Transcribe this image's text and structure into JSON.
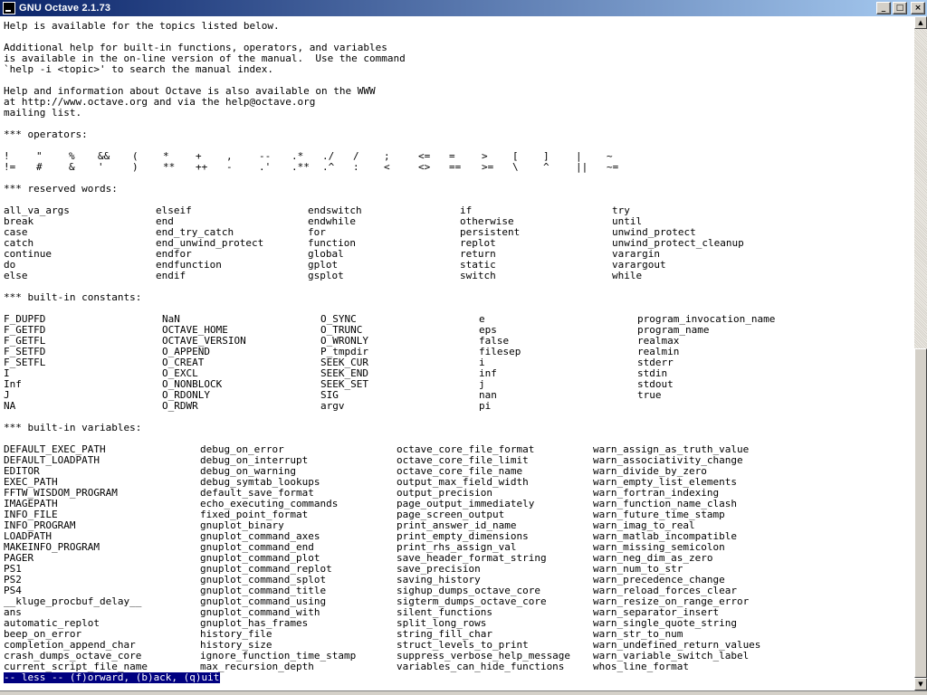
{
  "window": {
    "title": "GNU Octave 2.1.73",
    "minimize": "_",
    "maximize": "□",
    "close": "×"
  },
  "intro": [
    "Help is available for the topics listed below.",
    "",
    "Additional help for built-in functions, operators, and variables",
    "is available in the on-line version of the manual.  Use the command",
    "`help -i <topic>' to search the manual index.",
    "",
    "Help and information about Octave is also available on the WWW",
    "at http://www.octave.org and via the help@octave.org",
    "mailing list."
  ],
  "operators": {
    "heading": "*** operators:",
    "row1": [
      "!",
      "\"",
      "%",
      "&&",
      "(",
      "*",
      "+",
      ",",
      "--",
      ".*",
      "./",
      "/",
      ";",
      "<=",
      "=",
      ">",
      "[",
      "]",
      "|",
      "~"
    ],
    "row2": [
      "!=",
      "#",
      "&",
      "'",
      ")",
      "**",
      "++",
      "-",
      ".'",
      ".**",
      ".^",
      ":",
      "<",
      "<>",
      "==",
      ">=",
      "\\",
      "^",
      "||",
      "~="
    ]
  },
  "reserved": {
    "heading": "*** reserved words:",
    "rows": [
      [
        "all_va_args",
        "elseif",
        "endswitch",
        "if",
        "try"
      ],
      [
        "break",
        "end",
        "endwhile",
        "otherwise",
        "until"
      ],
      [
        "case",
        "end_try_catch",
        "for",
        "persistent",
        "unwind_protect"
      ],
      [
        "catch",
        "end_unwind_protect",
        "function",
        "replot",
        "unwind_protect_cleanup"
      ],
      [
        "continue",
        "endfor",
        "global",
        "return",
        "varargin"
      ],
      [
        "do",
        "endfunction",
        "gplot",
        "static",
        "varargout"
      ],
      [
        "else",
        "endif",
        "gsplot",
        "switch",
        "while"
      ]
    ]
  },
  "constants": {
    "heading": "*** built-in constants:",
    "rows": [
      [
        "F_DUPFD",
        "NaN",
        "O_SYNC",
        "e",
        "program_invocation_name"
      ],
      [
        "F_GETFD",
        "OCTAVE_HOME",
        "O_TRUNC",
        "eps",
        "program_name"
      ],
      [
        "F_GETFL",
        "OCTAVE_VERSION",
        "O_WRONLY",
        "false",
        "realmax"
      ],
      [
        "F_SETFD",
        "O_APPEND",
        "P_tmpdir",
        "filesep",
        "realmin"
      ],
      [
        "F_SETFL",
        "O_CREAT",
        "SEEK_CUR",
        "i",
        "stderr"
      ],
      [
        "I",
        "O_EXCL",
        "SEEK_END",
        "inf",
        "stdin"
      ],
      [
        "Inf",
        "O_NONBLOCK",
        "SEEK_SET",
        "j",
        "stdout"
      ],
      [
        "J",
        "O_RDONLY",
        "SIG",
        "nan",
        "true"
      ],
      [
        "NA",
        "O_RDWR",
        "argv",
        "pi",
        ""
      ]
    ]
  },
  "variables": {
    "heading": "*** built-in variables:",
    "rows": [
      [
        "DEFAULT_EXEC_PATH",
        "debug_on_error",
        "octave_core_file_format",
        "warn_assign_as_truth_value"
      ],
      [
        "DEFAULT_LOADPATH",
        "debug_on_interrupt",
        "octave_core_file_limit",
        "warn_associativity_change"
      ],
      [
        "EDITOR",
        "debug_on_warning",
        "octave_core_file_name",
        "warn_divide_by_zero"
      ],
      [
        "EXEC_PATH",
        "debug_symtab_lookups",
        "output_max_field_width",
        "warn_empty_list_elements"
      ],
      [
        "FFTW_WISDOM_PROGRAM",
        "default_save_format",
        "output_precision",
        "warn_fortran_indexing"
      ],
      [
        "IMAGEPATH",
        "echo_executing_commands",
        "page_output_immediately",
        "warn_function_name_clash"
      ],
      [
        "INFO_FILE",
        "fixed_point_format",
        "page_screen_output",
        "warn_future_time_stamp"
      ],
      [
        "INFO_PROGRAM",
        "gnuplot_binary",
        "print_answer_id_name",
        "warn_imag_to_real"
      ],
      [
        "LOADPATH",
        "gnuplot_command_axes",
        "print_empty_dimensions",
        "warn_matlab_incompatible"
      ],
      [
        "MAKEINFO_PROGRAM",
        "gnuplot_command_end",
        "print_rhs_assign_val",
        "warn_missing_semicolon"
      ],
      [
        "PAGER",
        "gnuplot_command_plot",
        "save_header_format_string",
        "warn_neg_dim_as_zero"
      ],
      [
        "PS1",
        "gnuplot_command_replot",
        "save_precision",
        "warn_num_to_str"
      ],
      [
        "PS2",
        "gnuplot_command_splot",
        "saving_history",
        "warn_precedence_change"
      ],
      [
        "PS4",
        "gnuplot_command_title",
        "sighup_dumps_octave_core",
        "warn_reload_forces_clear"
      ],
      [
        "__kluge_procbuf_delay__",
        "gnuplot_command_using",
        "sigterm_dumps_octave_core",
        "warn_resize_on_range_error"
      ],
      [
        "ans",
        "gnuplot_command_with",
        "silent_functions",
        "warn_separator_insert"
      ],
      [
        "automatic_replot",
        "gnuplot_has_frames",
        "split_long_rows",
        "warn_single_quote_string"
      ],
      [
        "beep_on_error",
        "history_file",
        "string_fill_char",
        "warn_str_to_num"
      ],
      [
        "completion_append_char",
        "history_size",
        "struct_levels_to_print",
        "warn_undefined_return_values"
      ],
      [
        "crash_dumps_octave_core",
        "ignore_function_time_stamp",
        "suppress_verbose_help_message",
        "warn_variable_switch_label"
      ],
      [
        "current_script_file_name",
        "max_recursion_depth",
        "variables_can_hide_functions",
        "whos_line_format"
      ]
    ]
  },
  "status": "-- less -- (f)orward, (b)ack, (q)uit"
}
